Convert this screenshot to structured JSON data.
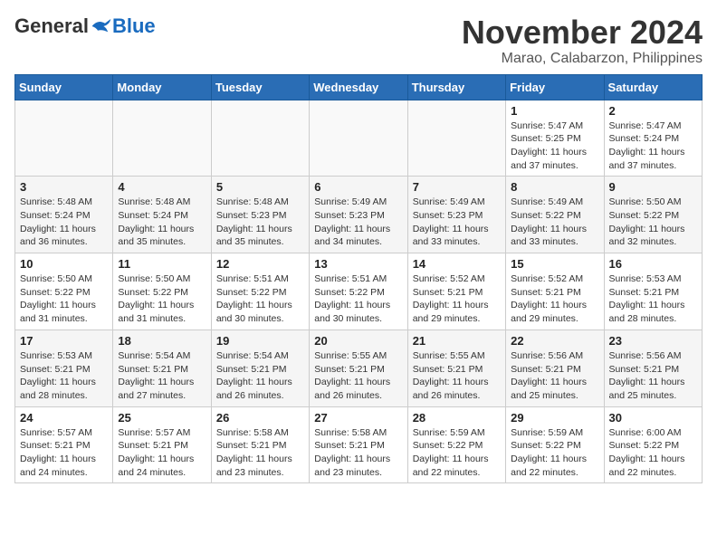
{
  "header": {
    "logo_general": "General",
    "logo_blue": "Blue",
    "title": "November 2024",
    "subtitle": "Marao, Calabarzon, Philippines"
  },
  "calendar": {
    "days_of_week": [
      "Sunday",
      "Monday",
      "Tuesday",
      "Wednesday",
      "Thursday",
      "Friday",
      "Saturday"
    ],
    "weeks": [
      [
        {
          "day": "",
          "info": ""
        },
        {
          "day": "",
          "info": ""
        },
        {
          "day": "",
          "info": ""
        },
        {
          "day": "",
          "info": ""
        },
        {
          "day": "",
          "info": ""
        },
        {
          "day": "1",
          "info": "Sunrise: 5:47 AM\nSunset: 5:25 PM\nDaylight: 11 hours and 37 minutes."
        },
        {
          "day": "2",
          "info": "Sunrise: 5:47 AM\nSunset: 5:24 PM\nDaylight: 11 hours and 37 minutes."
        }
      ],
      [
        {
          "day": "3",
          "info": "Sunrise: 5:48 AM\nSunset: 5:24 PM\nDaylight: 11 hours and 36 minutes."
        },
        {
          "day": "4",
          "info": "Sunrise: 5:48 AM\nSunset: 5:24 PM\nDaylight: 11 hours and 35 minutes."
        },
        {
          "day": "5",
          "info": "Sunrise: 5:48 AM\nSunset: 5:23 PM\nDaylight: 11 hours and 35 minutes."
        },
        {
          "day": "6",
          "info": "Sunrise: 5:49 AM\nSunset: 5:23 PM\nDaylight: 11 hours and 34 minutes."
        },
        {
          "day": "7",
          "info": "Sunrise: 5:49 AM\nSunset: 5:23 PM\nDaylight: 11 hours and 33 minutes."
        },
        {
          "day": "8",
          "info": "Sunrise: 5:49 AM\nSunset: 5:22 PM\nDaylight: 11 hours and 33 minutes."
        },
        {
          "day": "9",
          "info": "Sunrise: 5:50 AM\nSunset: 5:22 PM\nDaylight: 11 hours and 32 minutes."
        }
      ],
      [
        {
          "day": "10",
          "info": "Sunrise: 5:50 AM\nSunset: 5:22 PM\nDaylight: 11 hours and 31 minutes."
        },
        {
          "day": "11",
          "info": "Sunrise: 5:50 AM\nSunset: 5:22 PM\nDaylight: 11 hours and 31 minutes."
        },
        {
          "day": "12",
          "info": "Sunrise: 5:51 AM\nSunset: 5:22 PM\nDaylight: 11 hours and 30 minutes."
        },
        {
          "day": "13",
          "info": "Sunrise: 5:51 AM\nSunset: 5:22 PM\nDaylight: 11 hours and 30 minutes."
        },
        {
          "day": "14",
          "info": "Sunrise: 5:52 AM\nSunset: 5:21 PM\nDaylight: 11 hours and 29 minutes."
        },
        {
          "day": "15",
          "info": "Sunrise: 5:52 AM\nSunset: 5:21 PM\nDaylight: 11 hours and 29 minutes."
        },
        {
          "day": "16",
          "info": "Sunrise: 5:53 AM\nSunset: 5:21 PM\nDaylight: 11 hours and 28 minutes."
        }
      ],
      [
        {
          "day": "17",
          "info": "Sunrise: 5:53 AM\nSunset: 5:21 PM\nDaylight: 11 hours and 28 minutes."
        },
        {
          "day": "18",
          "info": "Sunrise: 5:54 AM\nSunset: 5:21 PM\nDaylight: 11 hours and 27 minutes."
        },
        {
          "day": "19",
          "info": "Sunrise: 5:54 AM\nSunset: 5:21 PM\nDaylight: 11 hours and 26 minutes."
        },
        {
          "day": "20",
          "info": "Sunrise: 5:55 AM\nSunset: 5:21 PM\nDaylight: 11 hours and 26 minutes."
        },
        {
          "day": "21",
          "info": "Sunrise: 5:55 AM\nSunset: 5:21 PM\nDaylight: 11 hours and 26 minutes."
        },
        {
          "day": "22",
          "info": "Sunrise: 5:56 AM\nSunset: 5:21 PM\nDaylight: 11 hours and 25 minutes."
        },
        {
          "day": "23",
          "info": "Sunrise: 5:56 AM\nSunset: 5:21 PM\nDaylight: 11 hours and 25 minutes."
        }
      ],
      [
        {
          "day": "24",
          "info": "Sunrise: 5:57 AM\nSunset: 5:21 PM\nDaylight: 11 hours and 24 minutes."
        },
        {
          "day": "25",
          "info": "Sunrise: 5:57 AM\nSunset: 5:21 PM\nDaylight: 11 hours and 24 minutes."
        },
        {
          "day": "26",
          "info": "Sunrise: 5:58 AM\nSunset: 5:21 PM\nDaylight: 11 hours and 23 minutes."
        },
        {
          "day": "27",
          "info": "Sunrise: 5:58 AM\nSunset: 5:21 PM\nDaylight: 11 hours and 23 minutes."
        },
        {
          "day": "28",
          "info": "Sunrise: 5:59 AM\nSunset: 5:22 PM\nDaylight: 11 hours and 22 minutes."
        },
        {
          "day": "29",
          "info": "Sunrise: 5:59 AM\nSunset: 5:22 PM\nDaylight: 11 hours and 22 minutes."
        },
        {
          "day": "30",
          "info": "Sunrise: 6:00 AM\nSunset: 5:22 PM\nDaylight: 11 hours and 22 minutes."
        }
      ]
    ]
  }
}
